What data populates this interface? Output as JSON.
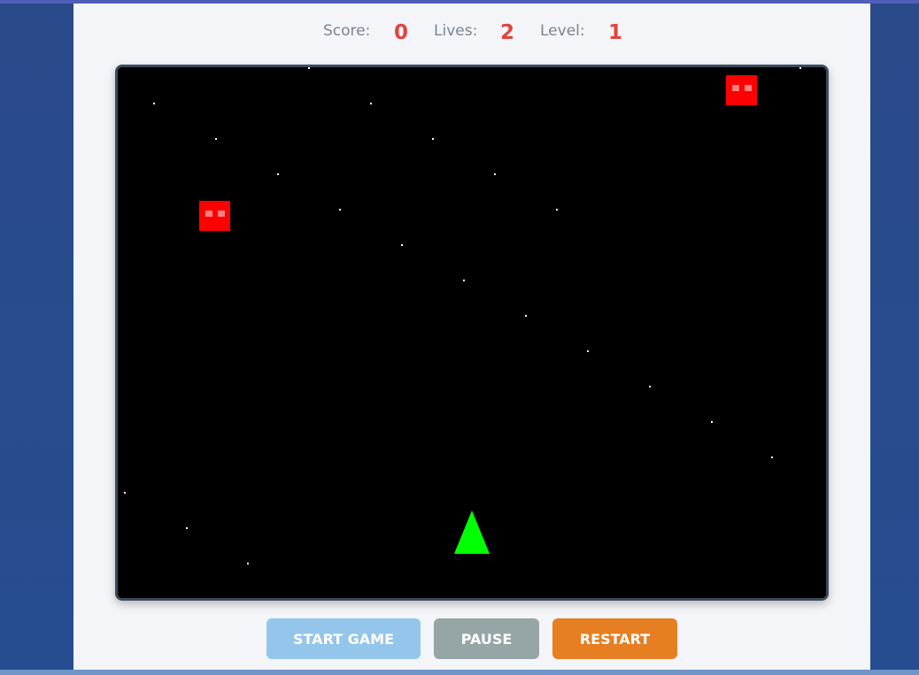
{
  "hud": {
    "score_label": "Score:",
    "score_value": "0",
    "lives_label": "Lives:",
    "lives_value": "2",
    "level_label": "Level:",
    "level_value": "1"
  },
  "controls": {
    "start_label": "START GAME",
    "pause_label": "PAUSE",
    "restart_label": "RESTART"
  },
  "colors": {
    "enemy": "#ff0000",
    "enemy_eye": "#ff7f7f",
    "player": "#00ff00",
    "star": "#ffffff",
    "canvas_bg": "#000000"
  },
  "game": {
    "player_icon": "player-ship-triangle",
    "enemy_icon": "enemy-square-with-eyes",
    "enemy_count": 2,
    "star_field": true
  }
}
